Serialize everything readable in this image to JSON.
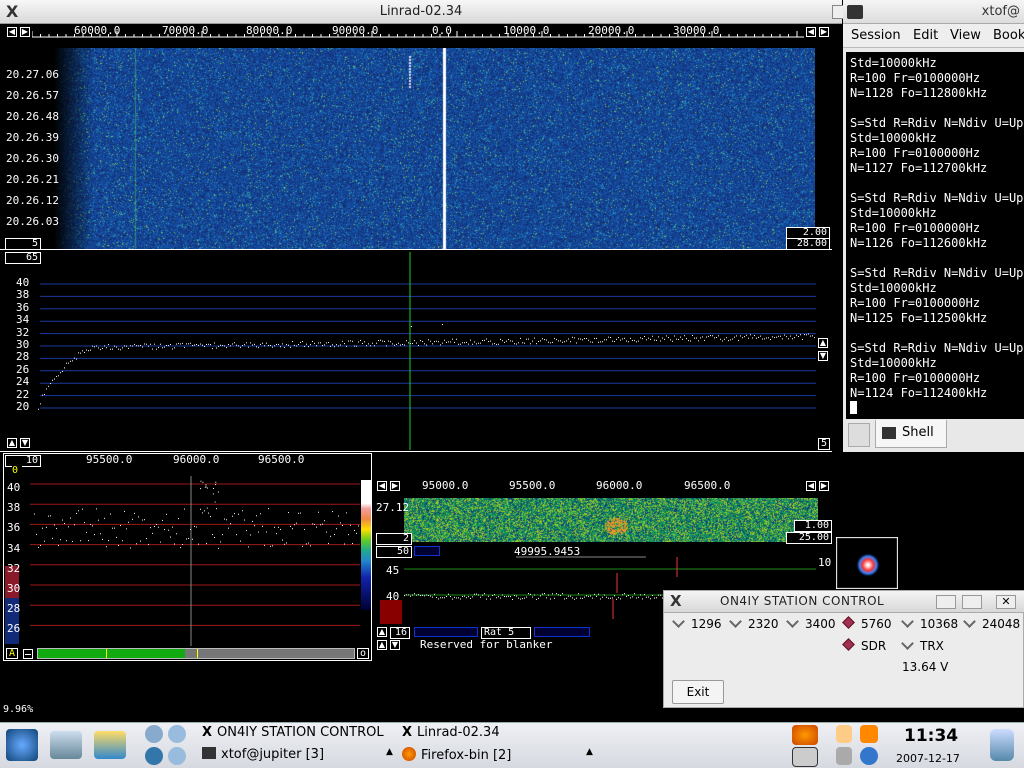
{
  "linrad": {
    "title": "Linrad-02.34",
    "wide_scale": [
      "60000.0",
      "70000.0",
      "80000.0",
      "90000.0",
      "0.0",
      "10000.0",
      "20000.0",
      "30000.0"
    ],
    "time_labels": [
      "20.27.06",
      "20.26.57",
      "20.26.48",
      "20.26.39",
      "20.26.30",
      "20.26.21",
      "20.26.12",
      "20.26.03"
    ],
    "wf_box_left": "5",
    "wf_box_r1": "2.00",
    "wf_box_r2": "28.00",
    "spec_box_left": "65",
    "spec_y_labels": [
      "40",
      "38",
      "36",
      "34",
      "32",
      "30",
      "28",
      "26",
      "24",
      "22",
      "20"
    ],
    "spec_box_right": "5",
    "bl_box": "10",
    "bl_scale": [
      "95500.0",
      "96000.0",
      "96500.0"
    ],
    "bl_zero": "0",
    "bl_y_labels": [
      "40",
      "38",
      "36",
      "34",
      "32",
      "30",
      "28",
      "26"
    ],
    "bl_btn_a": "A",
    "bl_btn_o": "o",
    "br_scale": [
      "95000.0",
      "95500.0",
      "96000.0",
      "96500.0"
    ],
    "br_left1": "27.12",
    "br_left2": "2",
    "br_right1": "1.00",
    "br_right2": "25.00",
    "br_box_50": "50",
    "br_freq": "49995.9453",
    "br_right_10": "10",
    "br_y45": "45",
    "br_y40": "40",
    "br_box_16": "16",
    "br_rat": "Rat  5",
    "br_reserved": "Reserved for blanker",
    "status_pct": "9.96%"
  },
  "konsole": {
    "title": "xtof@",
    "menu": [
      "Session",
      "Edit",
      "View",
      "Book"
    ],
    "lines": [
      "Std=10000kHz",
      "R=100 Fr=0100000Hz",
      "N=1128 Fo=112800kHz",
      "",
      "S=Std R=Rdiv N=Ndiv U=Up",
      "Std=10000kHz",
      "R=100 Fr=0100000Hz",
      "N=1127 Fo=112700kHz",
      "",
      "S=Std R=Rdiv N=Ndiv U=Up",
      "Std=10000kHz",
      "R=100 Fr=0100000Hz",
      "N=1126 Fo=112600kHz",
      "",
      "S=Std R=Rdiv N=Ndiv U=Up",
      "Std=10000kHz",
      "R=100 Fr=0100000Hz",
      "N=1125 Fo=112500kHz",
      "",
      "S=Std R=Rdiv N=Ndiv U=Up",
      "Std=10000kHz",
      "R=100 Fr=0100000Hz",
      "N=1124 Fo=112400kHz"
    ],
    "tab_label": "Shell"
  },
  "station": {
    "title": "ON4IY STATION CONTROL",
    "bands": [
      "1296",
      "2320",
      "3400",
      "5760",
      "10368",
      "24048"
    ],
    "selected_band": "5760",
    "modes": [
      "SDR",
      "TRX"
    ],
    "selected_mode": "SDR",
    "voltage": "13.64 V",
    "exit_label": "Exit"
  },
  "taskbar": {
    "tasks": [
      "ON4IY STATION CONTROL",
      "Linrad-02.34",
      "xtof@jupiter [3]",
      "Firefox-bin [2]"
    ],
    "time": "11:34",
    "date": "2007-12-17"
  },
  "colors": {
    "waterfall_bg": "#1a2f6e",
    "grid_blue": "#1a3aa0",
    "grid_red": "#a01818",
    "selected_radio": "#a03050"
  }
}
